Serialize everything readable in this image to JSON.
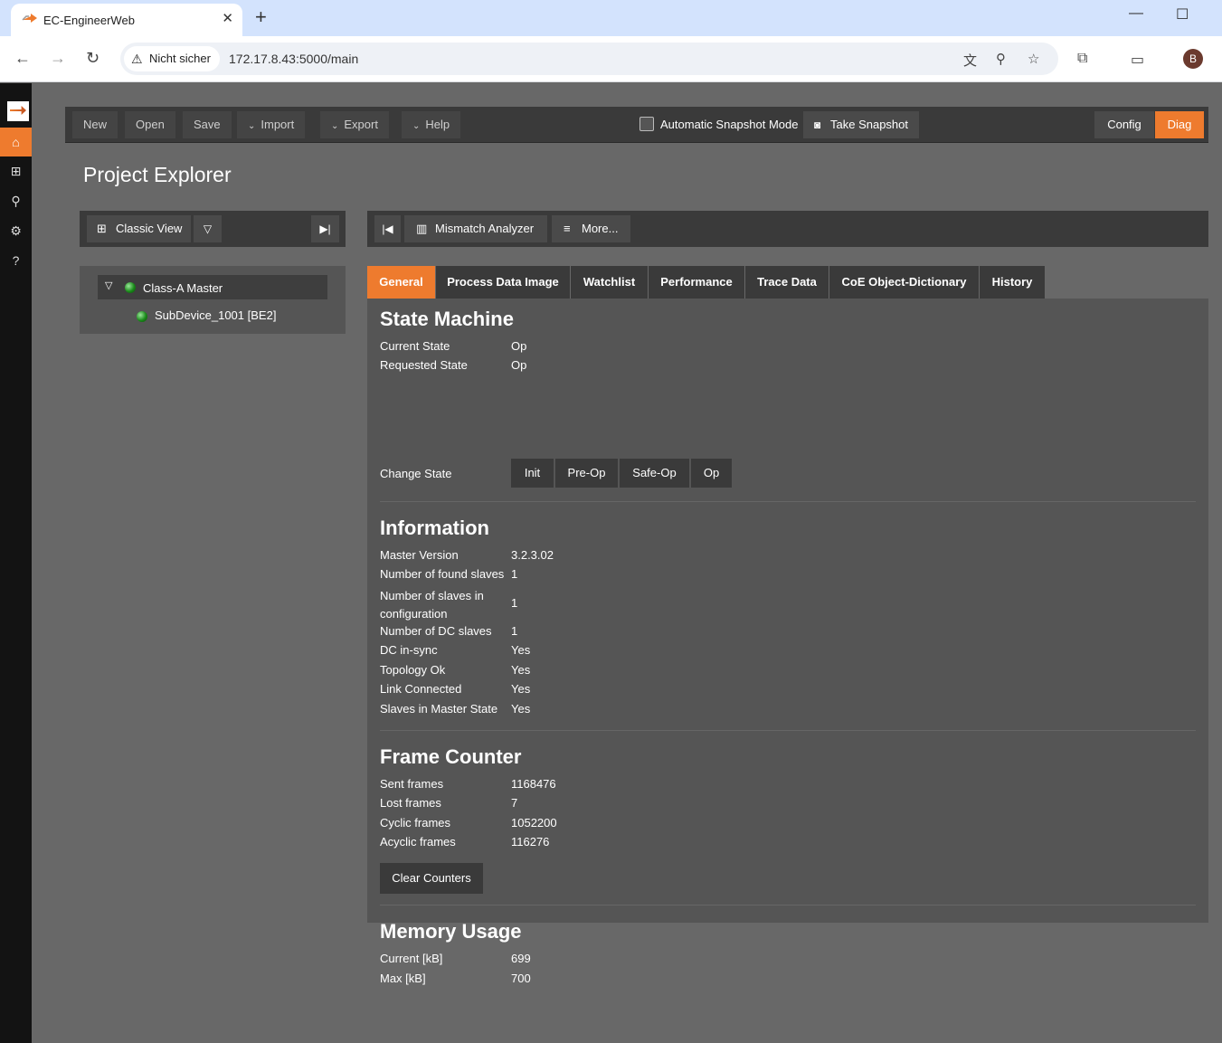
{
  "browser": {
    "tab_title": "EC-EngineerWeb",
    "tab_close": "✕",
    "new_tab": "+",
    "security_label": "Nicht sicher",
    "url": "172.17.8.43:5000/main",
    "avatar_letter": "B"
  },
  "sidebar": {
    "items": [
      "home",
      "grid",
      "search",
      "settings",
      "help"
    ],
    "active": "home"
  },
  "toolbar": {
    "new": "New",
    "open": "Open",
    "save": "Save",
    "import": "Import",
    "export": "Export",
    "help": "Help",
    "snapshot_mode": "Automatic Snapshot Mode",
    "take_snapshot": "Take Snapshot",
    "config": "Config",
    "diag": "Diag"
  },
  "page_title": "Project Explorer",
  "left_panel": {
    "view_button": "Classic View",
    "tree": [
      {
        "label": "Class-A Master",
        "status": "green"
      },
      {
        "label": "SubDevice_1001 [BE2]",
        "status": "green"
      }
    ]
  },
  "right_panel": {
    "mismatch": "Mismatch Analyzer",
    "more": "More...",
    "tabs": [
      "General",
      "Process Data Image",
      "Watchlist",
      "Performance",
      "Trace Data",
      "CoE Object-Dictionary",
      "History"
    ],
    "active_tab": "General"
  },
  "state_machine": {
    "title": "State Machine",
    "current_state_label": "Current State",
    "current_state": "Op",
    "requested_state_label": "Requested State",
    "requested_state": "Op",
    "change_state_label": "Change State",
    "buttons": [
      "Init",
      "Pre-Op",
      "Safe-Op",
      "Op"
    ]
  },
  "information": {
    "title": "Information",
    "rows": [
      {
        "label": "Master Version",
        "value": "3.2.3.02"
      },
      {
        "label": "Number of found slaves",
        "value": "1"
      },
      {
        "label": "Number of slaves in configuration",
        "value": "1"
      },
      {
        "label": "Number of DC slaves",
        "value": "1"
      },
      {
        "label": "DC in-sync",
        "value": "Yes"
      },
      {
        "label": "Topology Ok",
        "value": "Yes"
      },
      {
        "label": "Link Connected",
        "value": "Yes"
      },
      {
        "label": "Slaves in Master State",
        "value": "Yes"
      }
    ]
  },
  "frame_counter": {
    "title": "Frame Counter",
    "rows": [
      {
        "label": "Sent frames",
        "value": "1168476"
      },
      {
        "label": "Lost frames",
        "value": "7"
      },
      {
        "label": "Cyclic frames",
        "value": "1052200"
      },
      {
        "label": "Acyclic frames",
        "value": "116276"
      }
    ],
    "clear_button": "Clear Counters"
  },
  "memory_usage": {
    "title": "Memory Usage",
    "rows": [
      {
        "label": "Current [kB]",
        "value": "699"
      },
      {
        "label": "Max [kB]",
        "value": "700"
      }
    ]
  }
}
